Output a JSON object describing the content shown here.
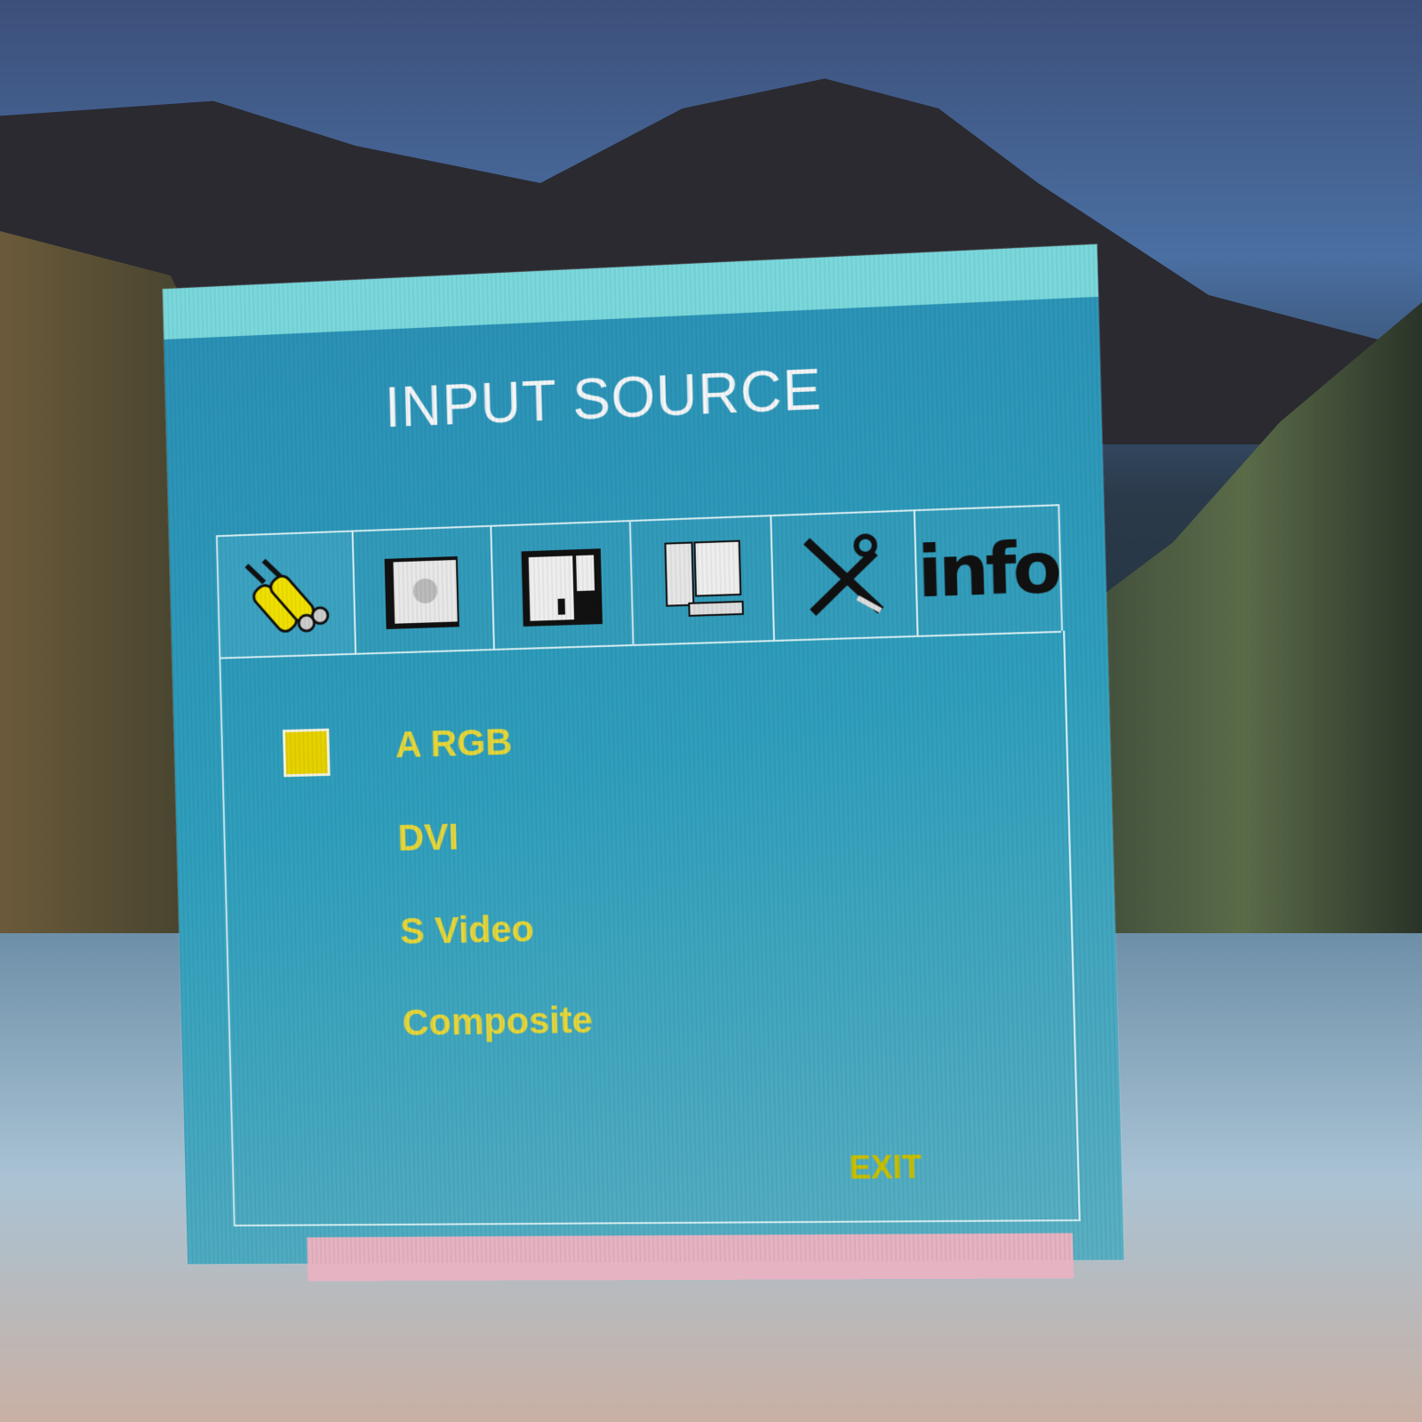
{
  "osd": {
    "title": "INPUT SOURCE",
    "tabs": [
      {
        "icon": "rca-cable-icon",
        "active": true
      },
      {
        "icon": "picture-settings-icon",
        "active": false
      },
      {
        "icon": "audio-icon",
        "active": false
      },
      {
        "icon": "computer-icon",
        "active": false
      },
      {
        "icon": "tools-icon",
        "active": false
      },
      {
        "icon": "info-icon",
        "label": "info",
        "active": false
      }
    ],
    "items": [
      {
        "label": "A RGB",
        "selected": true
      },
      {
        "label": "DVI",
        "selected": false
      },
      {
        "label": "S Video",
        "selected": false
      },
      {
        "label": "Composite",
        "selected": false
      }
    ],
    "exit_label": "EXIT"
  },
  "colors": {
    "panel": "#2f9fbd",
    "topbar": "#7ad8dc",
    "item_text": "#e6d73a",
    "selection": "#e6d200"
  }
}
